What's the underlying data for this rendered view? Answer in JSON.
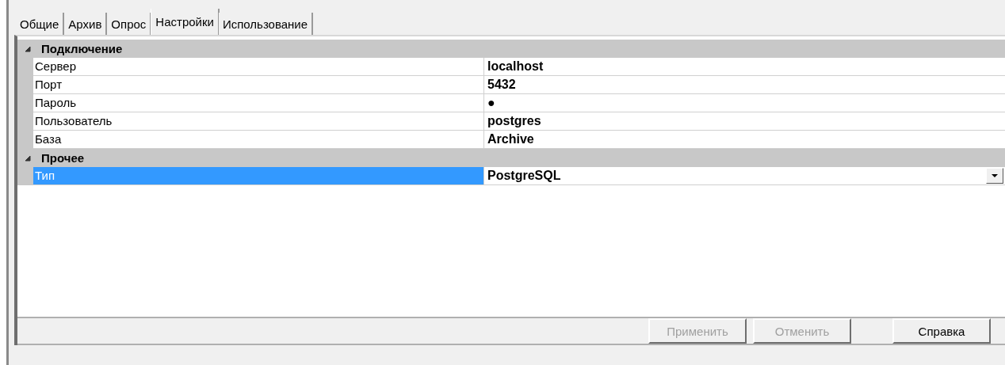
{
  "tabs": [
    {
      "label": "Общие",
      "selected": false
    },
    {
      "label": "Архив",
      "selected": false
    },
    {
      "label": "Опрос",
      "selected": false
    },
    {
      "label": "Настройки",
      "selected": true
    },
    {
      "label": "Использование",
      "selected": false
    }
  ],
  "property_grid": {
    "categories": [
      {
        "name": "Подключение",
        "expanded": true,
        "properties": [
          {
            "name": "Сервер",
            "value": "localhost",
            "kind": "text",
            "selected": false
          },
          {
            "name": "Порт",
            "value": "5432",
            "kind": "text",
            "selected": false
          },
          {
            "name": "Пароль",
            "value": "●",
            "kind": "text",
            "selected": false
          },
          {
            "name": "Пользователь",
            "value": "postgres",
            "kind": "text",
            "selected": false
          },
          {
            "name": "База",
            "value": "Archive",
            "kind": "text",
            "selected": false
          }
        ]
      },
      {
        "name": "Прочее",
        "expanded": true,
        "properties": [
          {
            "name": "Тип",
            "value": "PostgreSQL",
            "kind": "dropdown",
            "selected": true
          }
        ]
      }
    ]
  },
  "buttons": [
    {
      "label": "Применить",
      "disabled": true
    },
    {
      "label": "Отменить",
      "disabled": true
    },
    {
      "label": "Справка",
      "disabled": false
    }
  ]
}
